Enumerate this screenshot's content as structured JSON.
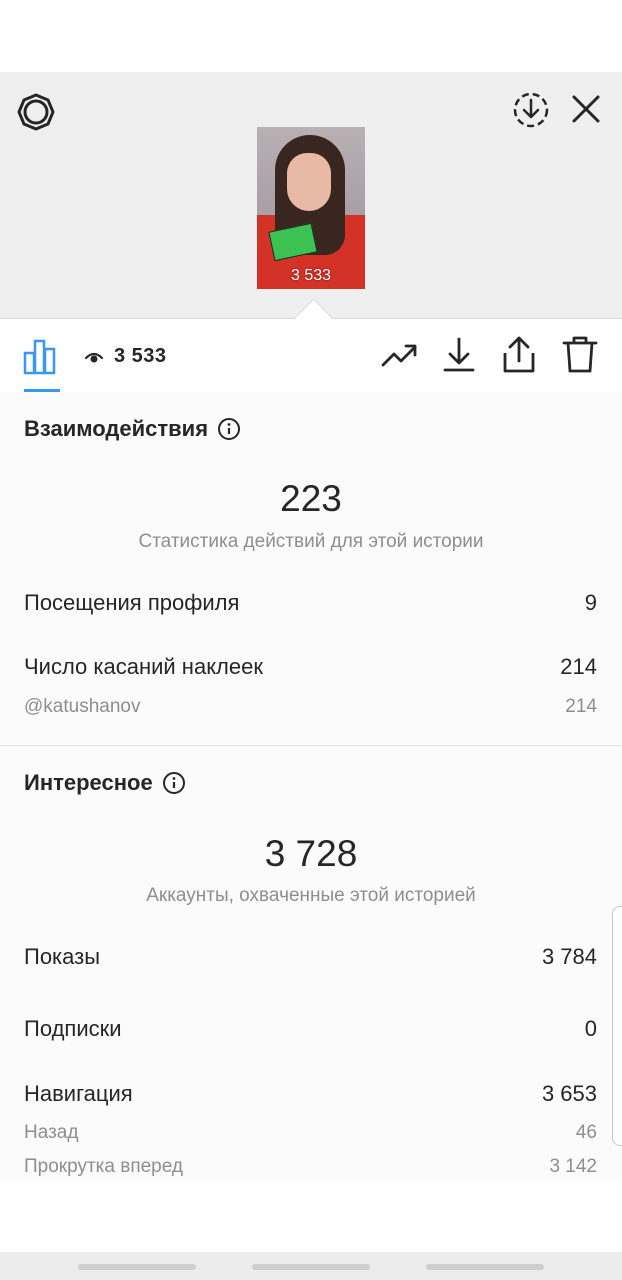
{
  "story": {
    "thumbnail_view_count": "3 533"
  },
  "toolbar": {
    "views": "3 533"
  },
  "interactions": {
    "title": "Взаимодействия",
    "total": "223",
    "subtitle": "Статистика действий для этой истории",
    "rows": [
      {
        "label": "Посещения профиля",
        "value": "9"
      },
      {
        "label": "Число касаний наклеек",
        "value": "214"
      }
    ],
    "sub_rows": [
      {
        "label": "@katushanov",
        "value": "214"
      }
    ]
  },
  "discovery": {
    "title": "Интересное",
    "total": "3 728",
    "subtitle": "Аккаунты, охваченные этой историей",
    "rows": [
      {
        "label": "Показы",
        "value": "3 784"
      },
      {
        "label": "Подписки",
        "value": "0"
      },
      {
        "label": "Навигация",
        "value": "3 653"
      }
    ],
    "sub_rows": [
      {
        "label": "Назад",
        "value": "46"
      },
      {
        "label": "Прокрутка вперед",
        "value": "3 142"
      }
    ]
  },
  "colors": {
    "accent": "#3897f0",
    "text": "#262626",
    "secondary": "#8e8e8e",
    "header_bg": "#efefef"
  },
  "icons": {
    "settings": "settings-gear-icon",
    "download_circle": "download-circle-icon",
    "close": "close-icon",
    "chart": "bar-chart-icon",
    "eye": "eye-icon",
    "trend": "trend-arrow-icon",
    "download": "download-icon",
    "share": "share-icon",
    "trash": "trash-icon",
    "info": "info-icon"
  }
}
